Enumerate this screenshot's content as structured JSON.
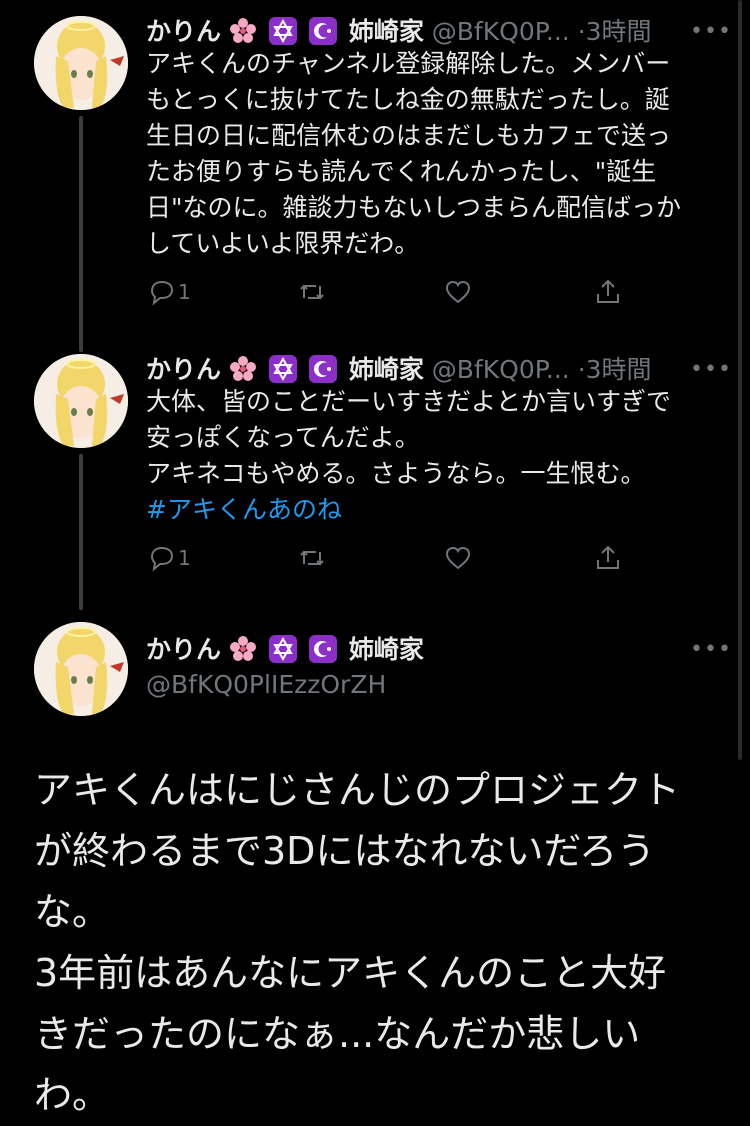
{
  "tweets": [
    {
      "name": "かりん",
      "org": "姉崎家",
      "handle": "@BfKQ0P...",
      "dot": "·",
      "time": "3時間",
      "lines": [
        "アキくんのチャンネル登録解除した。メンバー",
        "もとっくに抜けてたしね金の無駄だったし。誕",
        "生日の日に配信休むのはまだしもカフェで送っ",
        "たお便りすらも読んでくれんかったし、\"誕生",
        "日\"なのに。雑談力もないしつまらん配信ばっか",
        "していよいよ限界だわ。"
      ],
      "reply_count": "1"
    },
    {
      "name": "かりん",
      "org": "姉崎家",
      "handle": "@BfKQ0P...",
      "dot": "·",
      "time": "3時間",
      "lines": [
        "大体、皆のことだーいすきだよとか言いすぎで",
        "安っぽくなってんだよ。",
        "アキネコもやめる。さようなら。一生恨む。"
      ],
      "hashtag": "#アキくんあのね",
      "reply_count": "1"
    }
  ],
  "main_tweet": {
    "name": "かりん",
    "org": "姉崎家",
    "handle": "@BfKQ0PlIEzzOrZH",
    "lines": [
      "アキくんはにじさんじのプロジェクト",
      "が終わるまで3Dにはなれないだろう",
      "な。",
      "3年前はあんなにアキくんのこと大好",
      "きだったのになぁ...なんだか悲しい",
      "わ。"
    ]
  },
  "colors": {
    "background": "#000000",
    "text": "#e7e9ea",
    "secondary": "#71767b",
    "link": "#1d9bf0"
  },
  "icons": [
    "reply-icon",
    "retweet-icon",
    "like-icon",
    "share-icon",
    "more-icon",
    "cherry-blossom-icon",
    "star-of-david-icon",
    "star-crescent-icon"
  ]
}
